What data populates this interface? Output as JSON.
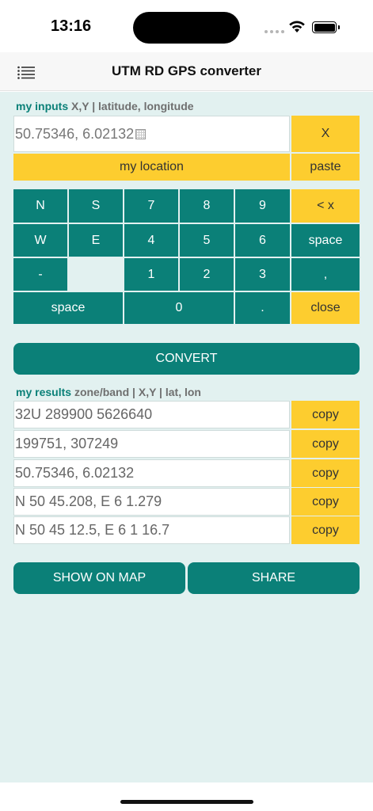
{
  "status": {
    "time": "13:16"
  },
  "header": {
    "title": "UTM RD GPS converter"
  },
  "inputs": {
    "label_accent": "my inputs",
    "label_rest": "X,Y | latitude, longitude",
    "value": "50.75346, 6.02132",
    "clear_label": "X",
    "my_location_label": "my location",
    "paste_label": "paste"
  },
  "keypad": {
    "row1": [
      "N",
      "S",
      "7",
      "8",
      "9",
      "< x"
    ],
    "row2": [
      "W",
      "E",
      "4",
      "5",
      "6",
      "space"
    ],
    "row3": [
      "-",
      "",
      "1",
      "2",
      "3",
      ","
    ],
    "row4": [
      "space",
      "0",
      ".",
      "close"
    ]
  },
  "convert_label": "CONVERT",
  "results": {
    "label_accent": "my results",
    "label_rest": "zone/band | X,Y | lat, lon",
    "rows": [
      {
        "value": "32U 289900 5626640",
        "copy": "copy"
      },
      {
        "value": "199751, 307249",
        "copy": "copy"
      },
      {
        "value": "50.75346, 6.02132",
        "copy": "copy"
      },
      {
        "value": "N 50 45.208, E 6 1.279",
        "copy": "copy"
      },
      {
        "value": "N 50 45 12.5, E 6 1 16.7",
        "copy": "copy"
      }
    ]
  },
  "actions": {
    "map_label": "SHOW ON MAP",
    "share_label": "SHARE"
  },
  "icons": {
    "menu": "menu-icon",
    "wifi": "wifi-icon",
    "battery": "battery-icon"
  },
  "colors": {
    "teal": "#0b8078",
    "yellow": "#fdcd2f",
    "background": "#e2f1f0"
  }
}
